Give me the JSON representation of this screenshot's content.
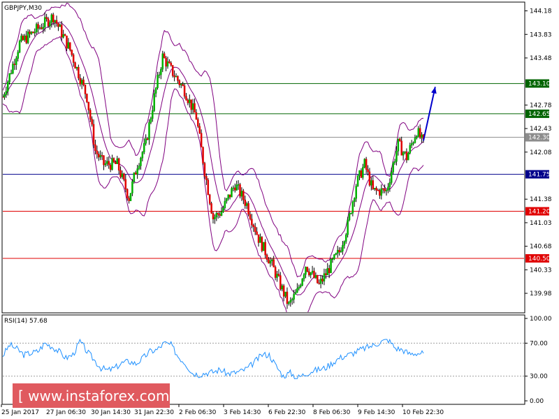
{
  "chart_data": [
    {
      "type": "candlestick",
      "title": "GBPJPY,M30",
      "ylim": [
        139.7,
        144.3
      ],
      "y_ticks": [
        "144.18",
        "143.83",
        "143.48",
        "142.78",
        "142.43",
        "142.08",
        "141.38",
        "141.03",
        "140.68",
        "140.33",
        "139.98"
      ],
      "x_ticks": [
        "25 Jan 2017",
        "27 Jan 06:30",
        "30 Jan 14:30",
        "31 Jan 22:30",
        "2 Feb 06:30",
        "3 Feb 14:30",
        "6 Feb 22:30",
        "8 Feb 06:30",
        "9 Feb 14:30",
        "10 Feb 22:30"
      ],
      "levels": [
        {
          "value": 143.1,
          "label": "143.10",
          "color": "#006400"
        },
        {
          "value": 142.65,
          "label": "142.65",
          "color": "#006400"
        },
        {
          "value": 142.3,
          "label": "142.30",
          "color": "#8c8c8c"
        },
        {
          "value": 141.75,
          "label": "141.75",
          "color": "#00008b"
        },
        {
          "value": 141.2,
          "label": "141.20",
          "color": "#e00000"
        },
        {
          "value": 140.5,
          "label": "140.50",
          "color": "#e00000"
        }
      ],
      "close_path": [
        [
          0,
          142.9
        ],
        [
          10,
          143.7
        ],
        [
          20,
          143.9
        ],
        [
          30,
          144.1
        ],
        [
          40,
          143.6
        ],
        [
          50,
          142.9
        ],
        [
          55,
          142.1
        ],
        [
          60,
          141.9
        ],
        [
          68,
          141.9
        ],
        [
          75,
          141.4
        ],
        [
          80,
          141.9
        ],
        [
          85,
          142.2
        ],
        [
          90,
          142.9
        ],
        [
          95,
          143.5
        ],
        [
          100,
          143.3
        ],
        [
          108,
          143.0
        ],
        [
          115,
          142.6
        ],
        [
          120,
          141.8
        ],
        [
          125,
          141.1
        ],
        [
          130,
          141.2
        ],
        [
          138,
          141.6
        ],
        [
          145,
          141.3
        ],
        [
          152,
          140.8
        ],
        [
          160,
          140.4
        ],
        [
          165,
          140.1
        ],
        [
          170,
          139.8
        ],
        [
          175,
          140.0
        ],
        [
          180,
          140.4
        ],
        [
          188,
          140.1
        ],
        [
          195,
          140.4
        ],
        [
          200,
          140.6
        ],
        [
          205,
          141.0
        ],
        [
          210,
          141.6
        ],
        [
          215,
          141.9
        ],
        [
          220,
          141.5
        ],
        [
          228,
          141.5
        ],
        [
          235,
          142.2
        ],
        [
          240,
          142.0
        ],
        [
          246,
          142.4
        ],
        [
          250,
          142.2
        ]
      ],
      "candles_per_step": 5,
      "arrow": {
        "from": [
          250,
          142.25
        ],
        "to": [
          257,
          143.05
        ],
        "color": "#0000cc"
      }
    },
    {
      "type": "line",
      "title": "RSI(14) 57.68",
      "ylim": [
        0,
        100
      ],
      "y_ticks": [
        "100.00",
        "70.00",
        "30.00",
        "0.00"
      ],
      "levels": [
        70,
        30
      ],
      "series": [
        {
          "values": [
            55,
            68,
            63,
            56,
            58,
            60,
            70,
            66,
            60,
            52,
            56,
            72,
            60,
            50,
            40,
            37,
            40,
            46,
            48,
            45,
            52,
            60,
            62,
            70,
            68,
            54,
            46,
            34,
            32,
            34,
            35,
            38,
            33,
            34,
            36,
            40,
            48,
            56,
            56,
            42,
            30,
            34,
            28,
            32,
            36,
            38,
            40,
            46,
            52,
            55,
            58,
            62,
            65,
            68,
            72,
            74,
            64,
            62,
            57,
            58,
            57.68
          ],
          "color": "#1e90ff"
        }
      ]
    }
  ],
  "watermark": "[ www.instaforex.com ]"
}
